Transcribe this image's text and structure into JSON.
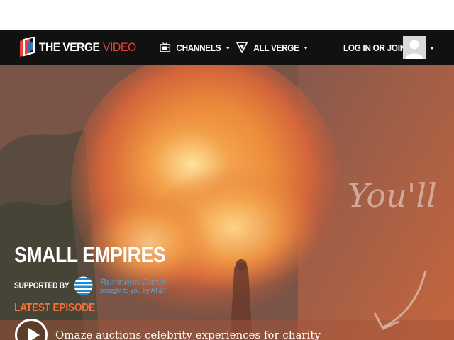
{
  "navbar": {
    "logo_text": "THE VERGE",
    "logo_sub": "VIDEO",
    "channels_label": "CHANNELS",
    "allverge_label": "ALL VERGE",
    "login_label": "LOG IN OR JOIN"
  },
  "hero": {
    "show_title": "SMALL EMPIRES",
    "supported_label": "SUPPORTED BY",
    "sponsor_name": "Business Circle",
    "sponsor_tagline": "brought to you by AT&T",
    "latest_label": "LATEST EPISODE",
    "episode_title": "Omaze auctions celebrity experiences for charity",
    "overlay_script": "You'll"
  },
  "colors": {
    "navbar_bg": "#111111",
    "accent_red": "#e8413c",
    "latest_orange": "#f2733a",
    "sponsor_blue": "#4aa3e0"
  },
  "icons": {
    "channels": "tv-icon",
    "allverge": "verge-triangle-icon",
    "play": "play-icon",
    "avatar": "user-avatar-icon",
    "sponsor": "att-globe-icon"
  }
}
